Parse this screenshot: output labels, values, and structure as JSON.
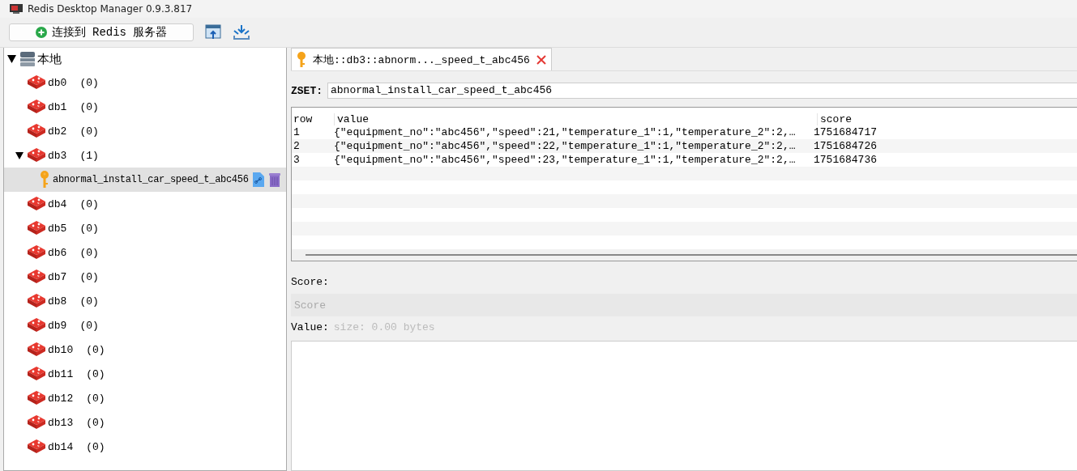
{
  "window": {
    "title": "Redis Desktop Manager 0.9.3.817"
  },
  "toolbar": {
    "connect_button": "连接到 Redis 服务器"
  },
  "tree": {
    "label": "本地",
    "children": [
      {
        "kind": "db",
        "label": "db0",
        "count": "(0)",
        "selected": false
      },
      {
        "kind": "db",
        "label": "db1",
        "count": "(0)",
        "selected": false
      },
      {
        "kind": "db",
        "label": "db2",
        "count": "(0)",
        "selected": false
      },
      {
        "kind": "db",
        "label": "db3",
        "count": "(1)",
        "selected": false,
        "children": [
          {
            "kind": "key",
            "label": "abnormal_install_car_speed_t_abc456",
            "selected": true
          }
        ]
      },
      {
        "kind": "db",
        "label": "db4",
        "count": "(0)",
        "selected": false
      },
      {
        "kind": "db",
        "label": "db5",
        "count": "(0)",
        "selected": false
      },
      {
        "kind": "db",
        "label": "db6",
        "count": "(0)",
        "selected": false
      },
      {
        "kind": "db",
        "label": "db7",
        "count": "(0)",
        "selected": false
      },
      {
        "kind": "db",
        "label": "db8",
        "count": "(0)",
        "selected": false
      },
      {
        "kind": "db",
        "label": "db9",
        "count": "(0)",
        "selected": false
      },
      {
        "kind": "db",
        "label": "db10",
        "count": "(0)",
        "selected": false
      },
      {
        "kind": "db",
        "label": "db11",
        "count": "(0)",
        "selected": false
      },
      {
        "kind": "db",
        "label": "db12",
        "count": "(0)",
        "selected": false
      },
      {
        "kind": "db",
        "label": "db13",
        "count": "(0)",
        "selected": false
      },
      {
        "kind": "db",
        "label": "db14",
        "count": "(0)",
        "selected": false
      }
    ]
  },
  "tab": {
    "label": "本地::db3::abnorm..._speed_t_abc456",
    "selected": true
  },
  "key_type": "ZSET:",
  "key_name": "abnormal_install_car_speed_t_abc456",
  "table": {
    "columns": [
      "row",
      "value",
      "score"
    ],
    "rows": [
      [
        "1",
        "{\"equipment_no\":\"abc456\",\"speed\":21,\"temperature_1\":1,\"temperature_2\":2,…",
        "1751684717"
      ],
      [
        "2",
        "{\"equipment_no\":\"abc456\",\"speed\":22,\"temperature_1\":1,\"temperature_2\":2,…",
        "1751684726"
      ],
      [
        "3",
        "{\"equipment_no\":\"abc456\",\"speed\":23,\"temperature_1\":1,\"temperature_2\":2,…",
        "1751684736"
      ]
    ]
  },
  "score": {
    "label": "Score:",
    "placeholder": "Score"
  },
  "value": {
    "label": "Value:",
    "hint": "size: 0.00 bytes"
  }
}
